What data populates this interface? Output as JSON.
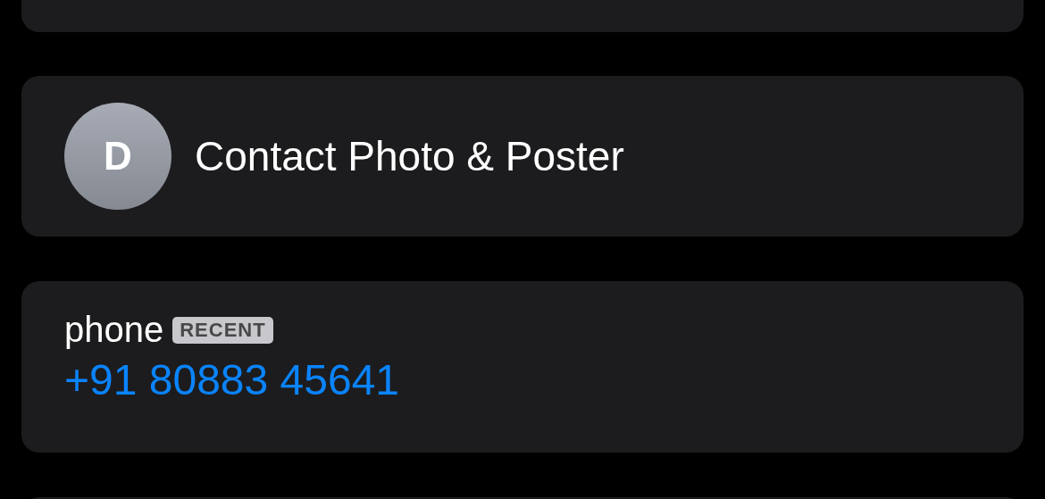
{
  "contact_card": {
    "avatar_initial": "D",
    "label": "Contact Photo & Poster"
  },
  "phone_card": {
    "label": "phone",
    "badge": "RECENT",
    "number": "+91 80883 45641"
  }
}
